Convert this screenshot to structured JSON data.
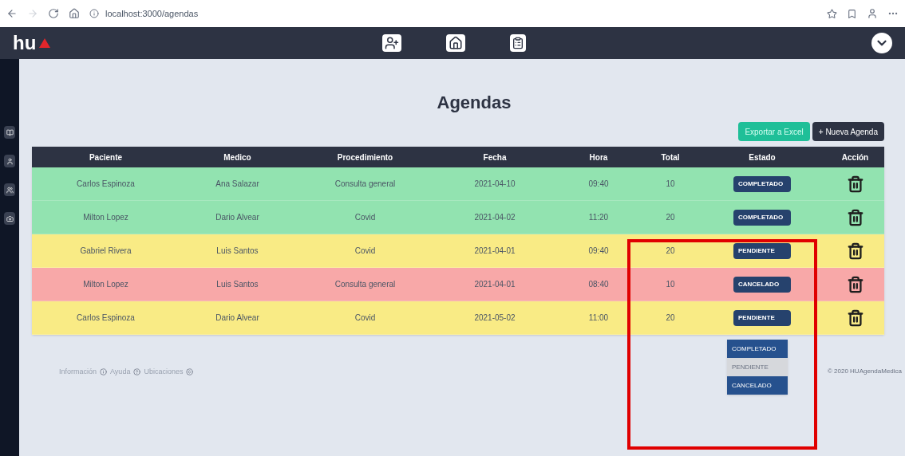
{
  "browser": {
    "address": "localhost:3000/agendas"
  },
  "navbar": {
    "logo": "hu"
  },
  "page": {
    "title": "Agendas"
  },
  "actions": [
    {
      "kind": "export",
      "label": "Exportar a Excel"
    },
    {
      "kind": "new",
      "label": "+ Nueva Agenda"
    }
  ],
  "table": {
    "columns": [
      "Paciente",
      "Medico",
      "Procedimiento",
      "Fecha",
      "Hora",
      "Total",
      "Estado",
      "Acción"
    ],
    "rows": [
      {
        "color": "#92e3b0",
        "cells": [
          "Carlos Espinoza",
          "Ana Salazar",
          "Consulta general",
          "2021-04-10",
          "09:40",
          "10"
        ],
        "estado": "COMPLETADO"
      },
      {
        "color": "#92e3b0",
        "cells": [
          "Milton Lopez",
          "Dario Alvear",
          "Covid",
          "2021-04-02",
          "11:20",
          "20"
        ],
        "estado": "COMPLETADO"
      },
      {
        "color": "#f9eb85",
        "cells": [
          "Gabriel Rivera",
          "Luis Santos",
          "Covid",
          "2021-04-01",
          "09:40",
          "20"
        ],
        "estado": "PENDIENTE"
      },
      {
        "color": "#f8a8a8",
        "cells": [
          "Milton Lopez",
          "Luis Santos",
          "Consulta general",
          "2021-04-01",
          "08:40",
          "10"
        ],
        "estado": "CANCELADO"
      },
      {
        "color": "#f9eb85",
        "cells": [
          "Carlos Espinoza",
          "Dario Alvear",
          "Covid",
          "2021-05-02",
          "11:00",
          "20"
        ],
        "estado": "PENDIENTE"
      }
    ]
  },
  "dropdown": {
    "options": [
      {
        "label": "COMPLETADO",
        "selected": false
      },
      {
        "label": "PENDIENTE",
        "selected": true
      },
      {
        "label": "CANCELADO",
        "selected": false
      }
    ]
  },
  "footer": {
    "links": [
      "Información",
      "Ayuda",
      "Ubicaciones"
    ],
    "copyright": "© 2020 HUAgendaMedica"
  }
}
